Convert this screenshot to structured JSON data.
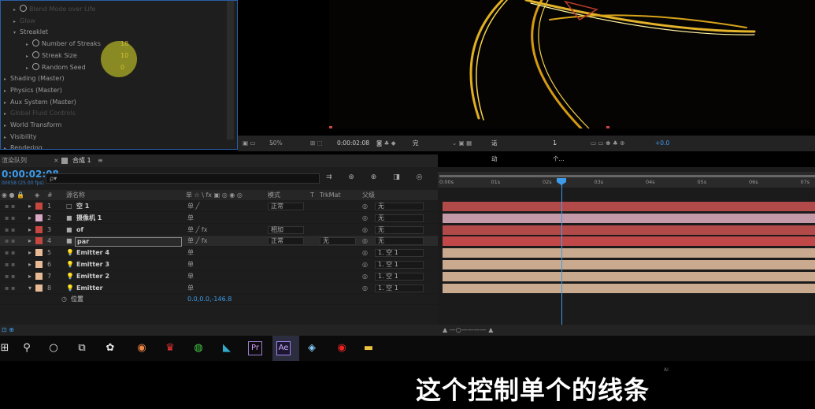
{
  "effects": {
    "rows": [
      {
        "label": "Blend Mode over Life",
        "tri": "▸",
        "sw": true,
        "dim": true
      },
      {
        "label": "Glow",
        "tri": "▸",
        "sw": false,
        "dim": true
      },
      {
        "label": "Streaklet",
        "tri": "▾",
        "sw": false,
        "dim": false
      },
      {
        "label": "Number of Streaks",
        "tri": "▸",
        "sw": true,
        "dim": false,
        "value": "18"
      },
      {
        "label": "Streak Size",
        "tri": "▸",
        "sw": true,
        "dim": false,
        "value": "10"
      },
      {
        "label": "Random Seed",
        "tri": "▸",
        "sw": true,
        "dim": false,
        "value": "0"
      },
      {
        "label": "Shading (Master)",
        "tri": "▸",
        "sw": false,
        "dim": false
      },
      {
        "label": "Physics (Master)",
        "tri": "▸",
        "sw": false,
        "dim": false
      },
      {
        "label": "Aux System (Master)",
        "tri": "▸",
        "sw": false,
        "dim": false
      },
      {
        "label": "Global Fluid Controls",
        "tri": "▸",
        "sw": false,
        "dim": true
      },
      {
        "label": "World Transform",
        "tri": "▸",
        "sw": false,
        "dim": false
      },
      {
        "label": "Visibility",
        "tri": "▸",
        "sw": false,
        "dim": false
      },
      {
        "label": "Rendering",
        "tri": "▸",
        "sw": false,
        "dim": false
      }
    ]
  },
  "viewer_bar": {
    "zoom": "50%",
    "timecode": "0:00:02:08",
    "resolution": "完整",
    "camera": "活动摄像机",
    "views": "1个...",
    "exposure": "+0.0"
  },
  "timeline": {
    "render_queue": "渲染队列",
    "comp_tab": "合成 1",
    "timecode": "0:00:02:08",
    "fps": "00058 (25.00 fps)",
    "search_placeholder": "ρ▾",
    "columns": {
      "num": "#",
      "source": "源名称",
      "switches": "单 ☆ \\ fx ▣ ◎ ◉ ◎",
      "mode": "模式",
      "t": "T",
      "trkmat": "TrkMat",
      "parent": "父级"
    },
    "layers": [
      {
        "num": "1",
        "name": "空 1",
        "color": "#c5473f",
        "icon": "□",
        "mode": "正常",
        "parent": "无"
      },
      {
        "num": "2",
        "name": "摄像机 1",
        "color": "#d9a8c2",
        "icon": "■",
        "mode": "",
        "parent": "无"
      },
      {
        "num": "3",
        "name": "of",
        "color": "#c5473f",
        "icon": "■",
        "mode": "相加",
        "parent": "无"
      },
      {
        "num": "4",
        "name": "par",
        "color": "#c5473f",
        "icon": "■",
        "mode": "正常",
        "trkmat": "无",
        "parent": "无"
      },
      {
        "num": "5",
        "name": "Emitter 4",
        "color": "#e7b994",
        "icon": "💡",
        "mode": "",
        "parent": "1. 空 1"
      },
      {
        "num": "6",
        "name": "Emitter 3",
        "color": "#e7b994",
        "icon": "💡",
        "mode": "",
        "parent": "1. 空 1"
      },
      {
        "num": "7",
        "name": "Emitter 2",
        "color": "#e7b994",
        "icon": "💡",
        "mode": "",
        "parent": "1. 空 1"
      },
      {
        "num": "8",
        "name": "Emitter",
        "color": "#e7b994",
        "icon": "💡",
        "mode": "",
        "parent": "1. 空 1"
      }
    ],
    "sub": {
      "label": "位置",
      "value": "0.0,0.0,-146.8"
    },
    "ruler": [
      "0:00s",
      "01s",
      "02s",
      "03s",
      "04s",
      "05s",
      "06s",
      "07s"
    ],
    "bar_colors": [
      "#b34a4a",
      "#c49aa8",
      "#b34a4a",
      "#c04848",
      "#c9aa8e",
      "#c9aa8e",
      "#c9aa8e",
      "#c9aa8e"
    ]
  },
  "subtitle": "这个控制单个的线条",
  "watermark": "AI"
}
